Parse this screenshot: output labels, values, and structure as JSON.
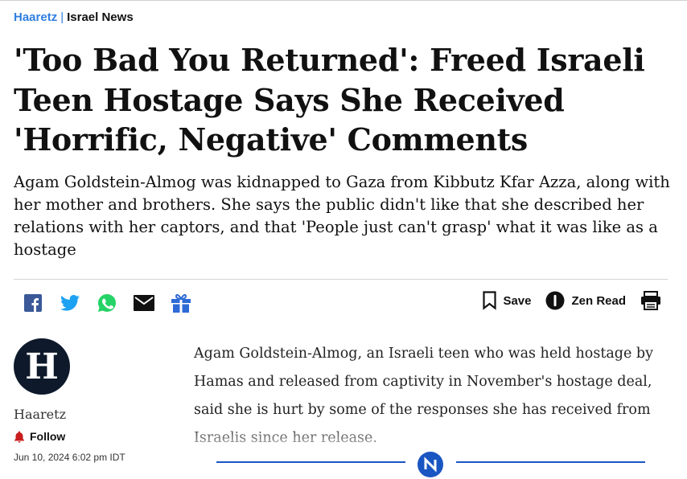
{
  "breadcrumb": {
    "brand": "Haaretz",
    "separator": "|",
    "section": "Israel News"
  },
  "headline": "'Too Bad You Returned': Freed Israeli Teen Hostage Says She Received 'Horrific, Negative' Comments",
  "subtitle": "Agam Goldstein-Almog was kidnapped to Gaza from Kibbutz Kfar Azza, along with her mother and brothers. She says the public didn't like that she described her relations with her captors, and that 'People just can't grasp' what it was like as a hostage",
  "share_icons": [
    "facebook-icon",
    "twitter-icon",
    "whatsapp-icon",
    "email-icon",
    "gift-icon"
  ],
  "actions": {
    "save_label": "Save",
    "zen_label": "Zen Read"
  },
  "author": {
    "avatar_letter": "H",
    "name": "Haaretz",
    "follow_label": "Follow",
    "date": "Jun 10, 2024 6:02 pm IDT"
  },
  "article": {
    "body": "Agam Goldstein-Almog, an Israeli teen who was held hostage by Hamas and released from captivity in November's hostage deal, said she is hurt by some of the responses she has received from Israelis since her release."
  },
  "colors": {
    "brand_blue": "#2f7fe0",
    "follow_red": "#c81e1e",
    "loader_blue": "#1a56c2",
    "facebook": "#3b5998",
    "twitter": "#1da1f2",
    "whatsapp": "#25d366"
  }
}
